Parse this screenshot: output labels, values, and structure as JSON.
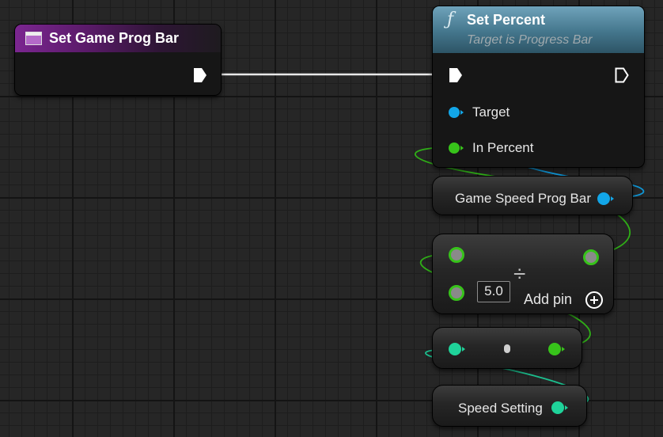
{
  "nodes": {
    "event": {
      "title": "Set Game Prog Bar"
    },
    "set_percent": {
      "title": "Set Percent",
      "subtitle": "Target is Progress Bar",
      "pins": {
        "target": "Target",
        "in_percent": "In Percent"
      }
    },
    "variable": {
      "label": "Game Speed Prog Bar"
    },
    "divide": {
      "operator": "÷",
      "input_value": "5.0",
      "add_pin": "Add pin"
    },
    "speed_setting": {
      "label": "Speed Setting"
    }
  },
  "colors": {
    "event_header": "#6a1f7a",
    "function_header": "#4e7d93",
    "object_pin": "#12a6e8",
    "float_pin": "#37c31a",
    "int_pin": "#1fd39a",
    "exec_wire": "#ffffff"
  },
  "icons": {
    "event": "widget-icon",
    "function": "function-f-icon",
    "add": "add-circle-icon"
  }
}
